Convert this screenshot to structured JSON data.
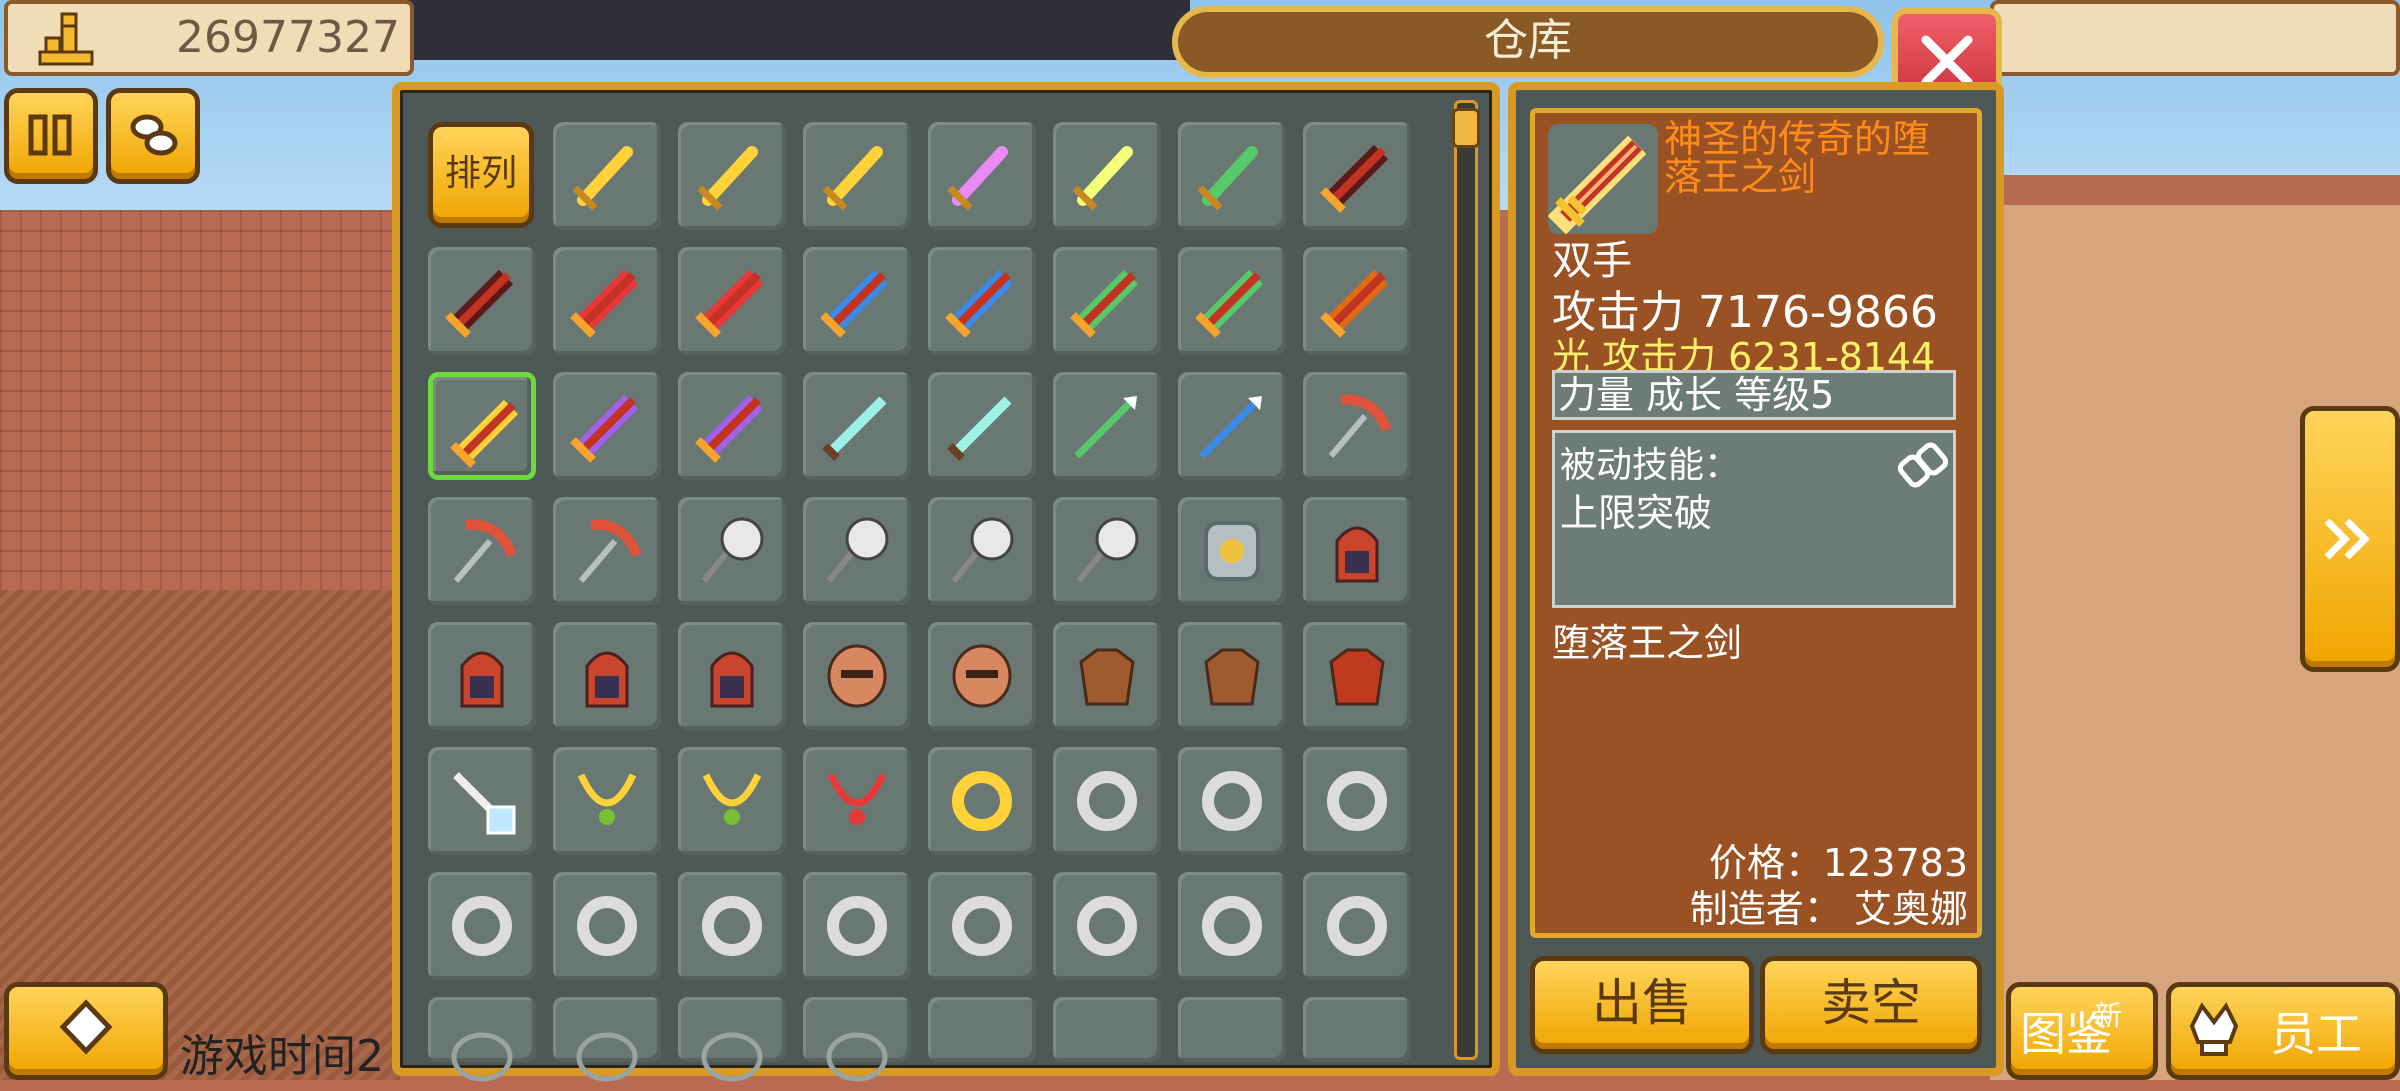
{
  "header": {
    "money_value": "26977327",
    "title": "仓库"
  },
  "grid": {
    "sort_label": "排列",
    "rows": [
      [
        "sword-gold",
        "sword-gold",
        "sword-gold",
        "sword-pink",
        "sword-yellow",
        "sword-green",
        "greatsword-dark"
      ],
      [
        "greatsword-dark",
        "greatsword-red",
        "greatsword-red",
        "greatsword-blue",
        "greatsword-blue",
        "greatsword-green",
        "greatsword-green",
        "greatsword-orange"
      ],
      [
        "greatsword-gold",
        "greatsword-purple",
        "greatsword-purple",
        "blade-cyan",
        "blade-cyan",
        "spear-green",
        "spear-blue",
        "pickaxe"
      ],
      [
        "pickaxe",
        "pickaxe",
        "axe-white",
        "axe-white",
        "axe-white",
        "axe-white",
        "shield-steel",
        "armor-hood"
      ],
      [
        "armor-hood",
        "armor-hood",
        "armor-hood",
        "helmet-copper",
        "helmet-copper",
        "armor-leather",
        "armor-leather-purple",
        "armor-cloak"
      ],
      [
        "wand-crystal",
        "necklace-gold",
        "necklace-gold",
        "necklace-red",
        "ring-gold",
        "ring-silver",
        "ring-silver",
        "ring-silver"
      ],
      [
        "ring-silver",
        "ring-silver",
        "ring-silver",
        "ring-silver",
        "ring-silver",
        "ring-silver",
        "ring-silver",
        "ring-silver"
      ],
      [
        "rope",
        "rope",
        "rope",
        "rope",
        "empty",
        "empty",
        "empty",
        "empty"
      ]
    ],
    "selected_row": 2,
    "selected_col": 0
  },
  "detail": {
    "item_name": "神圣的传奇的堕落王之剑",
    "hand_type": "双手",
    "attack": "攻击力 7176-9866",
    "light_attack": "光 攻击力 6231-8144",
    "stat": "力量 成长 等级5",
    "passive_title": "被动技能：",
    "passive_skill": "上限突破",
    "base_name": "堕落王之剑",
    "price": "价格：123783",
    "maker": "制造者： 艾奥娜"
  },
  "buttons": {
    "sell": "出售",
    "sell_all": "卖空",
    "catalog": "图鉴",
    "new_badge": "新",
    "staff": "员工"
  },
  "footer": {
    "game_time": "游戏时间2"
  },
  "colors": {
    "gold": "#f0a400",
    "panel_bg": "#4e5857",
    "title_orange": "#ff8c1a",
    "selected_border": "#6cdc3c"
  }
}
